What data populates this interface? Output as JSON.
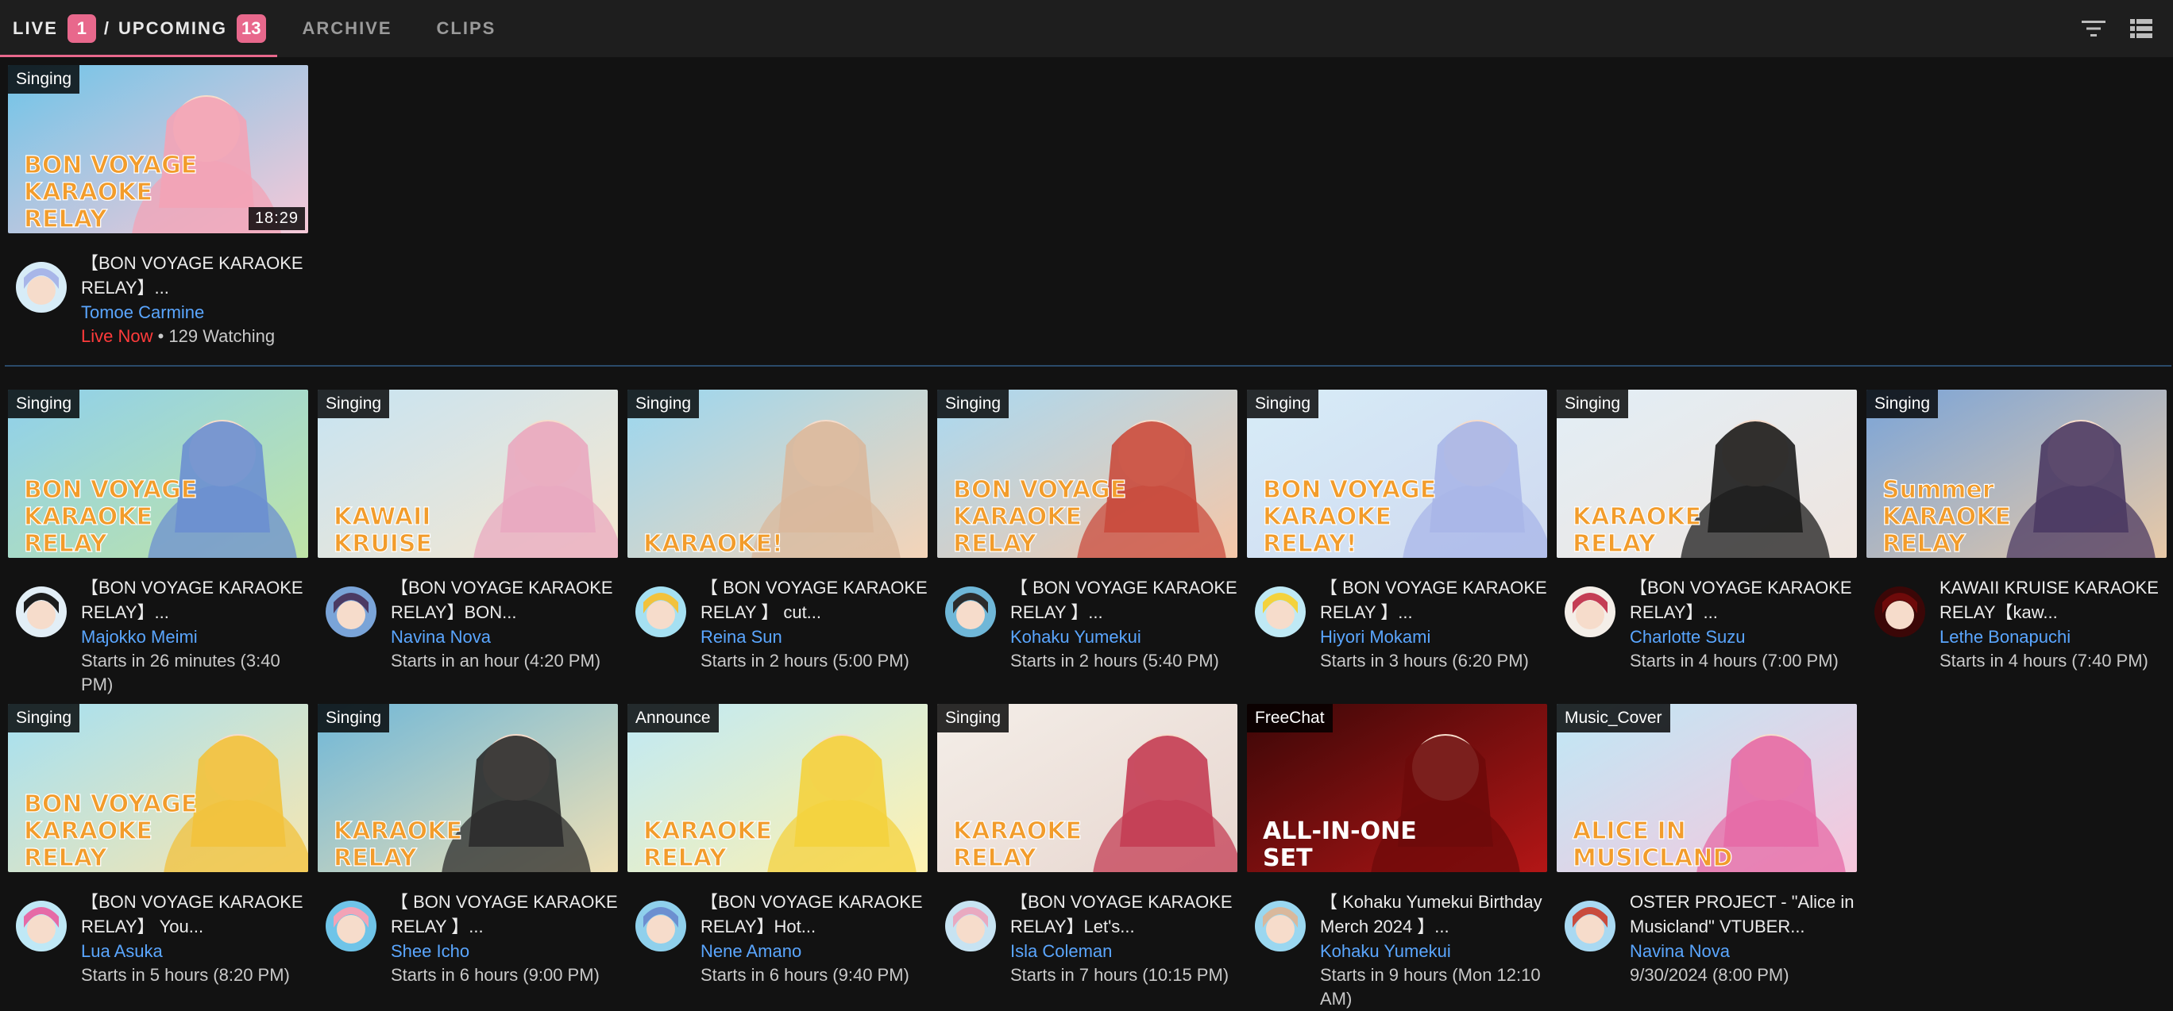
{
  "tabs": {
    "live_label": "LIVE",
    "live_count": "1",
    "separator": "/",
    "upcoming_label": "UPCOMING",
    "upcoming_count": "13",
    "archive_label": "ARCHIVE",
    "clips_label": "CLIPS"
  },
  "toolbar_icons": [
    "filter-icon",
    "list-view-icon"
  ],
  "colors": {
    "accent": "#e8688c",
    "link": "#5aa6ff",
    "live": "#ff3b3b",
    "background": "#121212"
  },
  "live": [
    {
      "topic": "Singing",
      "duration": "18:29",
      "title": "【BON VOYAGE KARAOKE RELAY】...",
      "channel": "Tomoe Carmine",
      "live_label": "Live Now",
      "watching": " • 129 Watching",
      "thumb_text": "BON VOYAGE KARAOKE RELAY"
    }
  ],
  "upcoming": [
    {
      "topic": "Singing",
      "title": "【BON VOYAGE KARAOKE RELAY】...",
      "channel": "Majokko Meimi",
      "status": "Starts in 26 minutes (3:40 PM)",
      "thumb_text": "BON VOYAGE KARAOKE RELAY"
    },
    {
      "topic": "Singing",
      "title": "【BON VOYAGE KARAOKE RELAY】BON...",
      "channel": "Navina Nova",
      "status": "Starts in an hour (4:20 PM)",
      "thumb_text": "KAWAII KRUISE"
    },
    {
      "topic": "Singing",
      "title": "【 BON VOYAGE KARAOKE RELAY 】 cut...",
      "channel": "Reina Sun",
      "status": "Starts in 2 hours (5:00 PM)",
      "thumb_text": "KARAOKE!"
    },
    {
      "topic": "Singing",
      "title": "【 BON VOYAGE KARAOKE RELAY 】...",
      "channel": "Kohaku Yumekui",
      "status": "Starts in 2 hours (5:40 PM)",
      "thumb_text": "BON VOYAGE KARAOKE RELAY"
    },
    {
      "topic": "Singing",
      "title": "【 BON VOYAGE KARAOKE RELAY 】...",
      "channel": "Hiyori Mokami",
      "status": "Starts in 3 hours (6:20 PM)",
      "thumb_text": "BON VOYAGE KARAOKE RELAY!"
    },
    {
      "topic": "Singing",
      "title": "【BON VOYAGE KARAOKE RELAY】...",
      "channel": "Charlotte Suzu",
      "status": "Starts in 4 hours (7:00 PM)",
      "thumb_text": "KARAOKE RELAY"
    },
    {
      "topic": "Singing",
      "title": "KAWAII KRUISE KARAOKE RELAY【kaw...",
      "channel": "Lethe Bonapuchi",
      "status": "Starts in 4 hours (7:40 PM)",
      "thumb_text": "Summer KARAOKE RELAY"
    },
    {
      "topic": "Singing",
      "title": "【BON VOYAGE KARAOKE RELAY】 You...",
      "channel": "Lua Asuka",
      "status": "Starts in 5 hours (8:20 PM)",
      "thumb_text": "BON VOYAGE KARAOKE RELAY"
    },
    {
      "topic": "Singing",
      "title": "【 BON VOYAGE KARAOKE RELAY 】...",
      "channel": "Shee Icho",
      "status": "Starts in 6 hours (9:00 PM)",
      "thumb_text": "KARAOKE RELAY"
    },
    {
      "topic": "Announce",
      "title": "【BON VOYAGE KARAOKE RELAY】Hot...",
      "channel": "Nene Amano",
      "status": "Starts in 6 hours (9:40 PM)",
      "thumb_text": "KARAOKE RELAY"
    },
    {
      "topic": "Singing",
      "title": "【BON VOYAGE KARAOKE RELAY】Let's...",
      "channel": "Isla Coleman",
      "status": "Starts in 7 hours (10:15 PM)",
      "thumb_text": "KARAOKE RELAY"
    },
    {
      "topic": "FreeChat",
      "title": "【 Kohaku Yumekui Birthday Merch 2024 】...",
      "channel": "Kohaku Yumekui",
      "status": "Starts in 9 hours (Mon 12:10 AM)",
      "thumb_text": "ALL-IN-ONE SET"
    },
    {
      "topic": "Music_Cover",
      "title": "OSTER PROJECT - \"Alice in Musicland\" VTUBER...",
      "channel": "Navina Nova",
      "status": "9/30/2024 (8:00 PM)",
      "thumb_text": "ALICE IN MUSICLAND"
    }
  ]
}
